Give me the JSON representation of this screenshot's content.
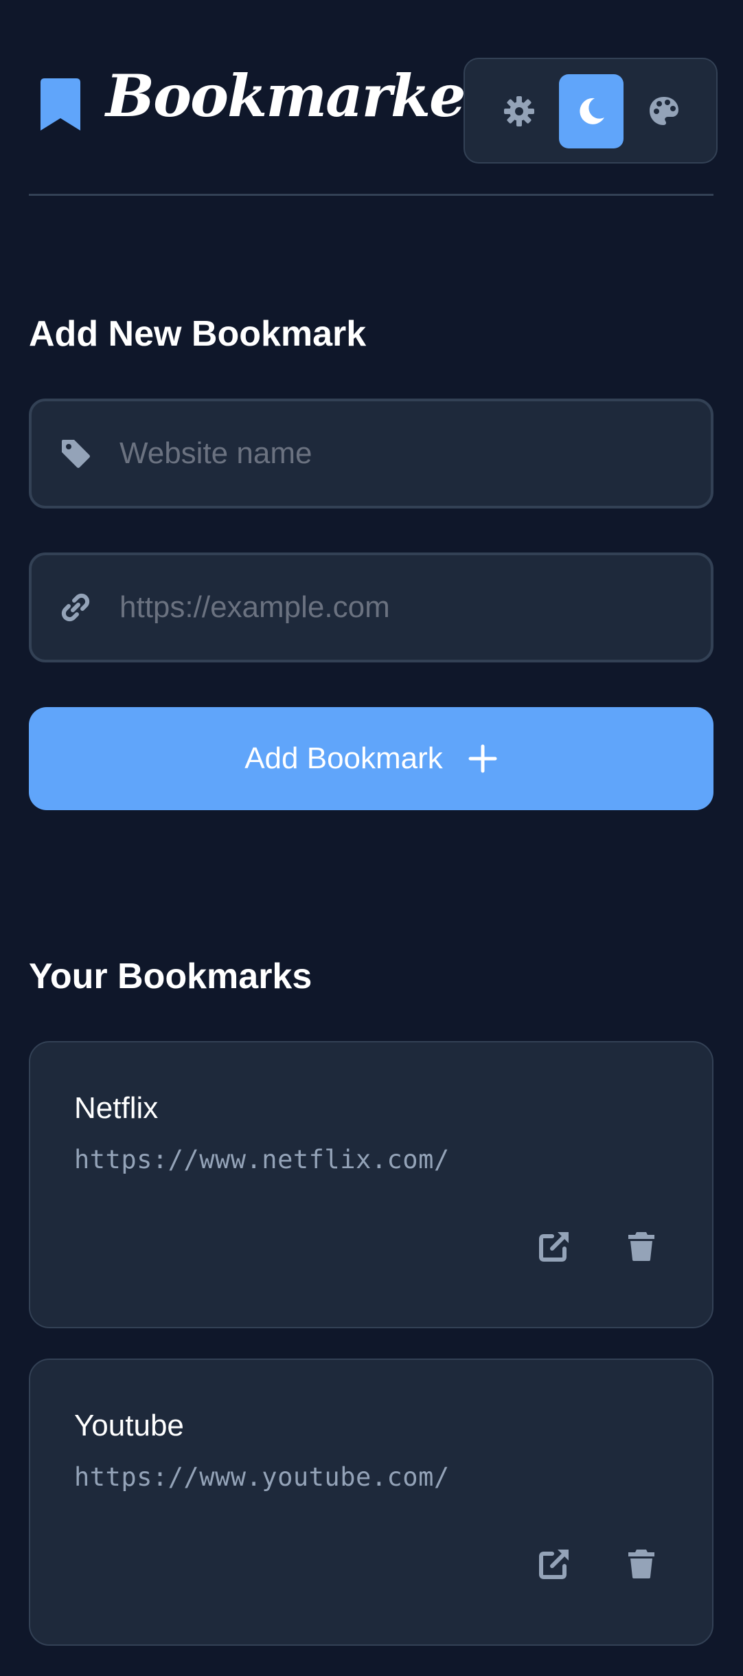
{
  "app": {
    "title": "Bookmarker"
  },
  "theme_switcher": {
    "options": [
      {
        "name": "light",
        "icon": "gear-icon",
        "active": false
      },
      {
        "name": "dark",
        "icon": "moon-icon",
        "active": true
      },
      {
        "name": "custom",
        "icon": "palette-icon",
        "active": false
      }
    ]
  },
  "add_section": {
    "title": "Add New Bookmark",
    "name_input": {
      "placeholder": "Website name",
      "value": "",
      "icon": "tag-icon"
    },
    "url_input": {
      "placeholder": "https://example.com",
      "value": "",
      "icon": "link-icon"
    },
    "add_button_label": "Add Bookmark",
    "add_button_icon": "plus-icon"
  },
  "bookmarks_section": {
    "title": "Your Bookmarks",
    "items": [
      {
        "name": "Netflix",
        "url": "https://www.netflix.com/"
      },
      {
        "name": "Youtube",
        "url": "https://www.youtube.com/"
      }
    ],
    "actions": {
      "open_icon": "external-link-icon",
      "delete_icon": "trash-icon"
    }
  },
  "colors": {
    "background": "#0f172a",
    "surface": "#1e293b",
    "border": "#334155",
    "accent": "#60a5fa",
    "muted_text": "#94a3b8",
    "icon": "#94a3b8",
    "placeholder": "#6b7280"
  }
}
